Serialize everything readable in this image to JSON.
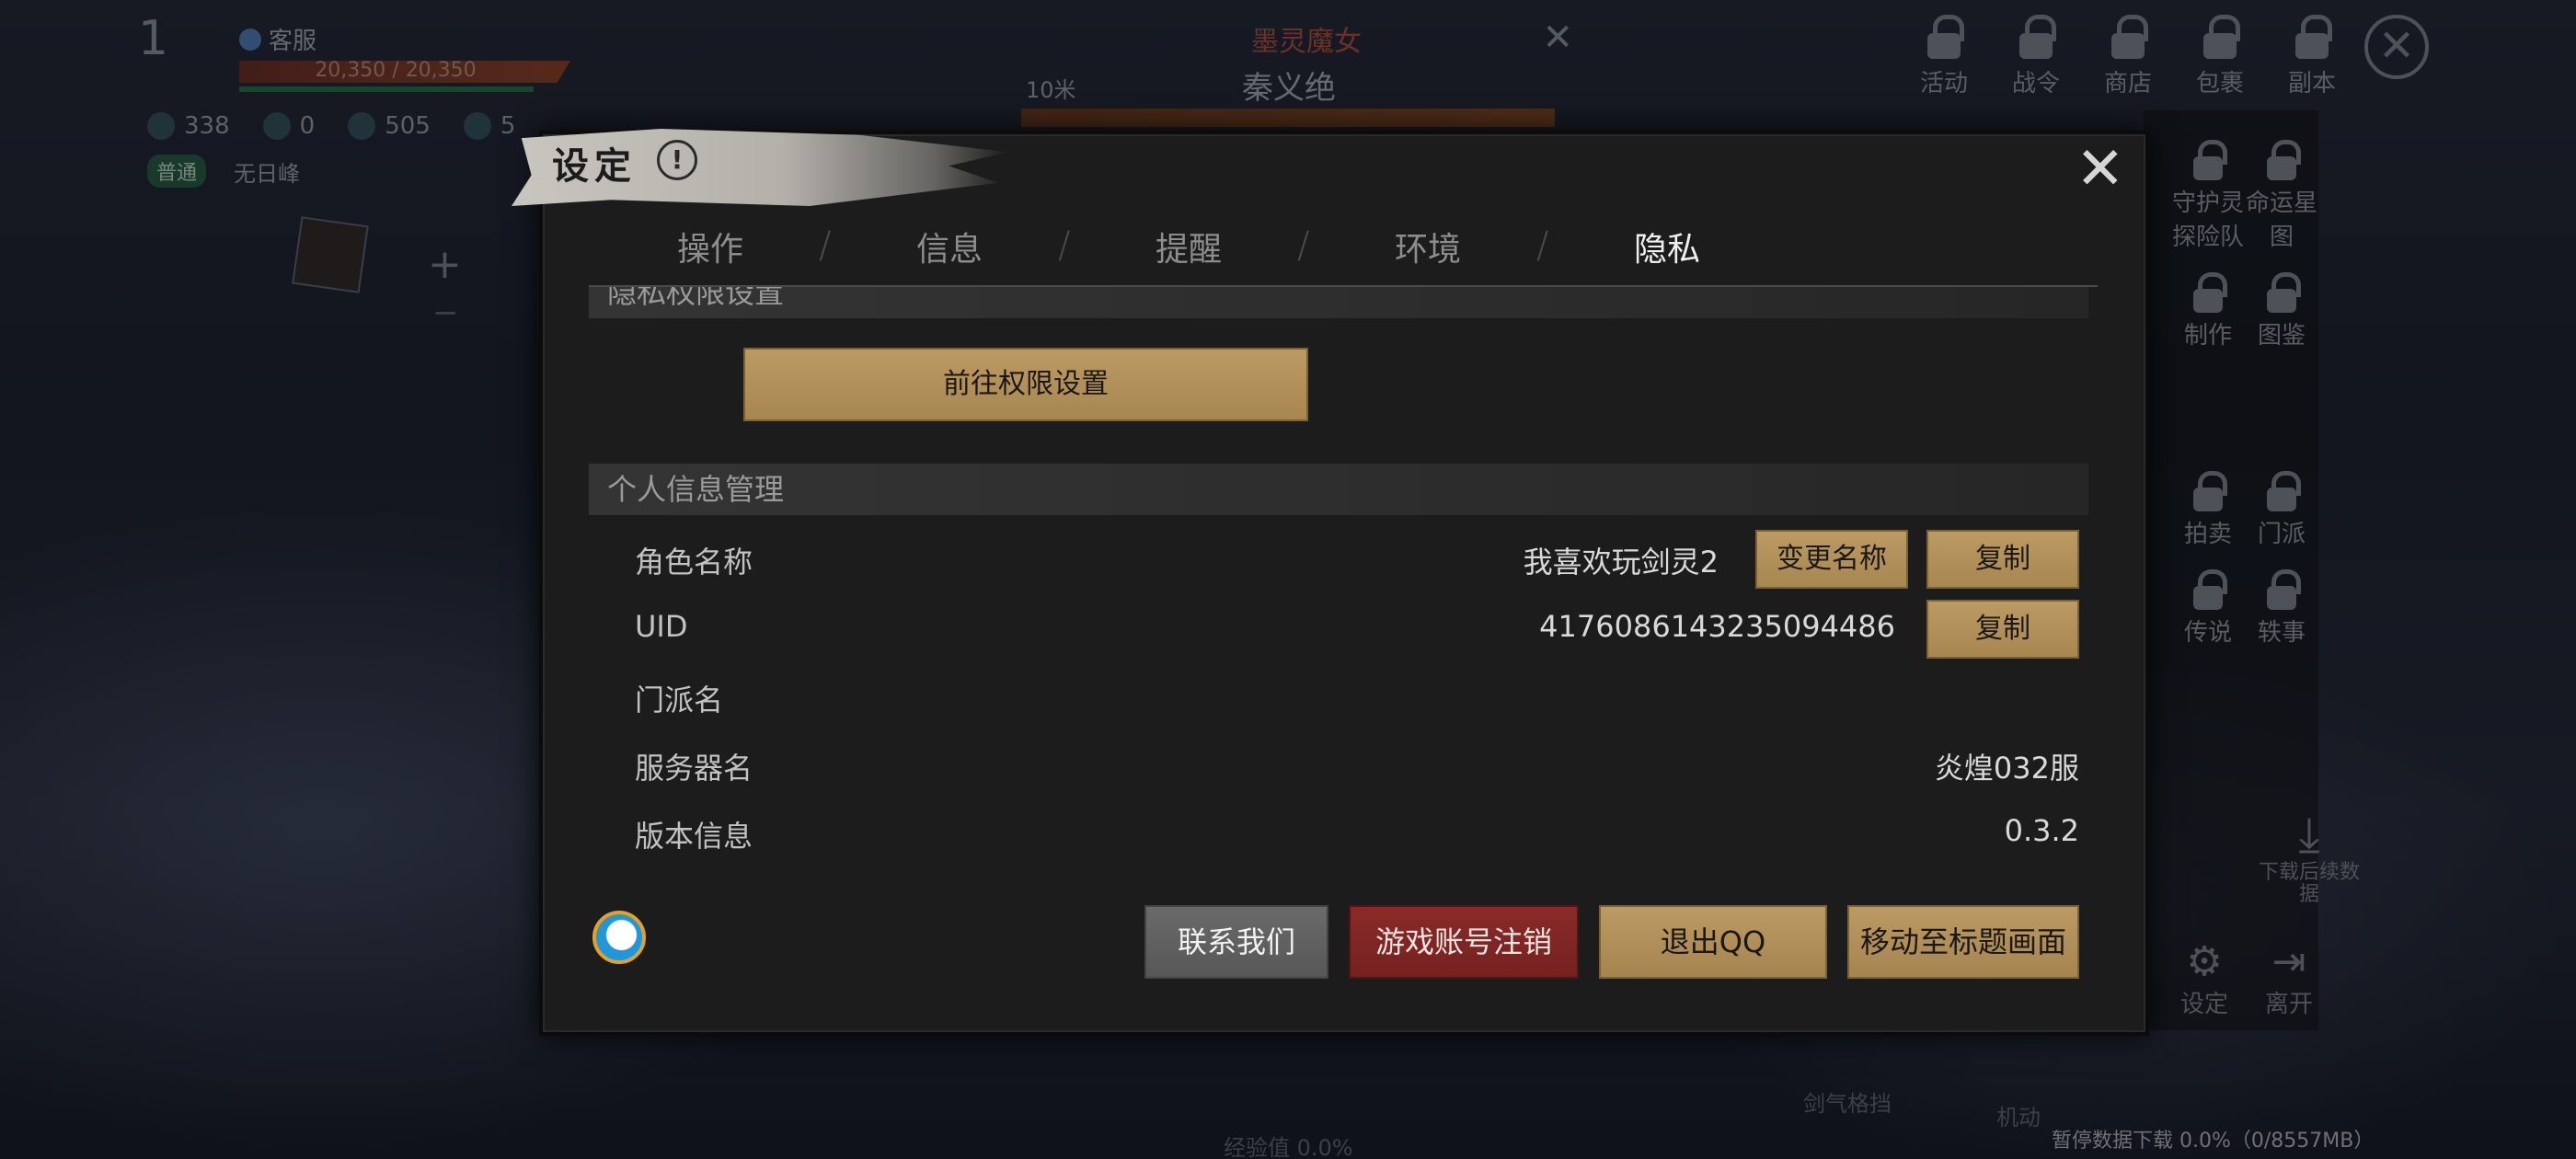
{
  "hud": {
    "level": "1",
    "customer_service": "客服",
    "hp_text": "20,350 / 20,350",
    "stat_1": "338",
    "stat_2": "0",
    "stat_3": "505",
    "stat_4": "5",
    "mode_tag": "普通",
    "location": "无日峰",
    "map_plus": "+",
    "map_minus": "−"
  },
  "target": {
    "boss_title": "墨灵魔女",
    "name": "秦义绝",
    "distance": "10米",
    "close": "✕"
  },
  "top_menu": [
    "活动",
    "战令",
    "商店",
    "包裹",
    "副本"
  ],
  "side_menu": [
    "守护灵探险队",
    "命运星图",
    "制作",
    "图鉴",
    "拍卖",
    "门派",
    "传说",
    "轶事"
  ],
  "download_label": "下载后续数据",
  "bottom_right": {
    "settings": "设定",
    "leave": "离开"
  },
  "bottom_status": "暂停数据下载 0.0%（0/8557MB）",
  "exp_text": "经验值 0.0%",
  "skills": {
    "skill_a": "剑气格挡",
    "skill_b": "机动"
  },
  "dialog": {
    "title": "设定",
    "info_icon": "!",
    "close": "✕",
    "tabs": [
      "操作",
      "信息",
      "提醒",
      "环境",
      "隐私"
    ],
    "active_tab": "隐私",
    "privacy_section": "隐私权限设置",
    "goto_permission": "前往权限设置",
    "personal_section": "个人信息管理",
    "rows": {
      "char_name_label": "角色名称",
      "char_name_value": "我喜欢玩剑灵2",
      "change_name": "变更名称",
      "copy": "复制",
      "uid_label": "UID",
      "uid_value": "4176086143235094486",
      "guild_label": "门派名",
      "server_label": "服务器名",
      "server_value": "炎煌032服",
      "version_label": "版本信息",
      "version_value": "0.3.2"
    },
    "footer": {
      "contact": "联系我们",
      "delete_account": "游戏账号注销",
      "logout_qq": "退出QQ",
      "to_title": "移动至标题画面"
    }
  }
}
